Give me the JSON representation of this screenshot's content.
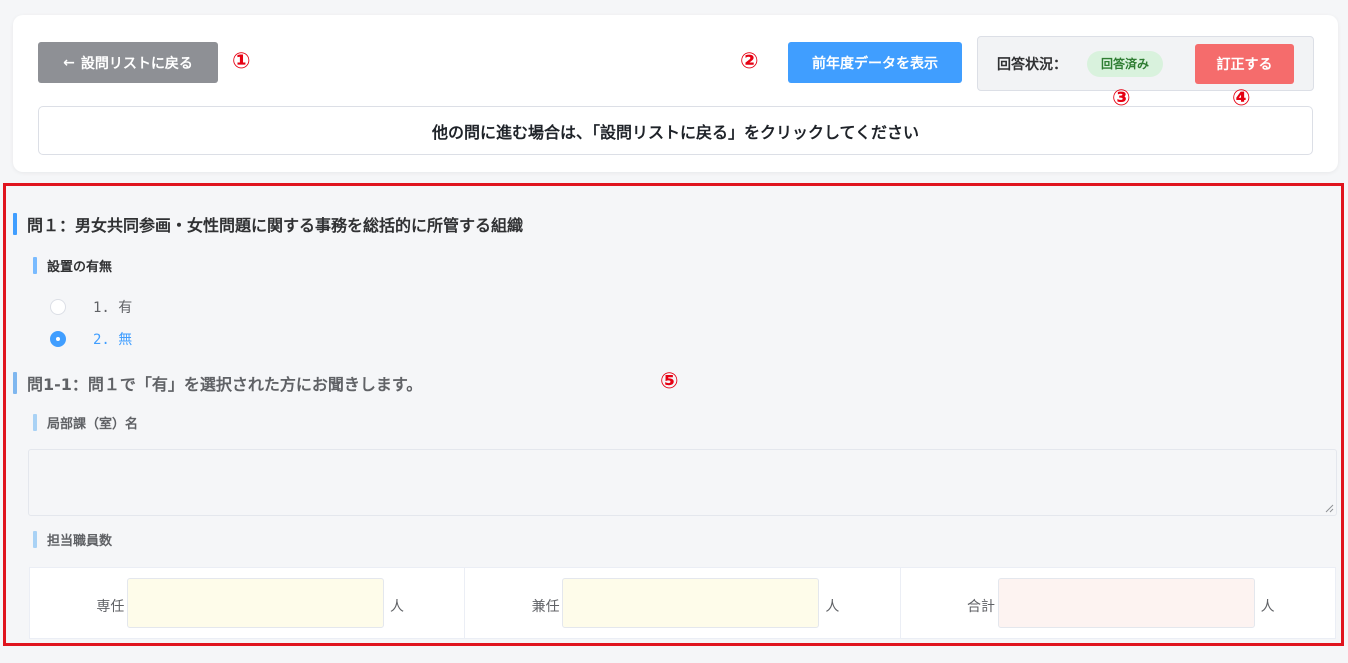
{
  "header": {
    "back_label": "設問リストに戻る",
    "back_icon": "arrow-left-icon",
    "prev_year_label": "前年度データを表示",
    "status_label": "回答状況：",
    "status_value": "回答済み",
    "correct_label": "訂正する",
    "notice": "他の問に進む場合は、「設問リストに戻る」をクリックしてください"
  },
  "markers": [
    "①",
    "②",
    "③",
    "④",
    "⑤"
  ],
  "q1": {
    "title": "問１：男女共同参画・女性問題に関する事務を総括的に所管する組織",
    "sub_label": "設置の有無",
    "options": [
      {
        "label": "1. 有",
        "selected": false
      },
      {
        "label": "2. 無",
        "selected": true
      }
    ]
  },
  "q1_1": {
    "title": "問1-1：問１で「有」を選択された方にお聞きします。",
    "dept_label": "局部課（室）名",
    "dept_value": "",
    "staff_label": "担当職員数",
    "staff": [
      {
        "label": "専任",
        "value": "",
        "unit": "人"
      },
      {
        "label": "兼任",
        "value": "",
        "unit": "人"
      },
      {
        "label": "合計",
        "value": "",
        "unit": "人"
      }
    ]
  },
  "colors": {
    "accent": "#409eff",
    "danger": "#f56c6c",
    "marker": "#e60012",
    "badge_bg": "#d9f2dd"
  }
}
